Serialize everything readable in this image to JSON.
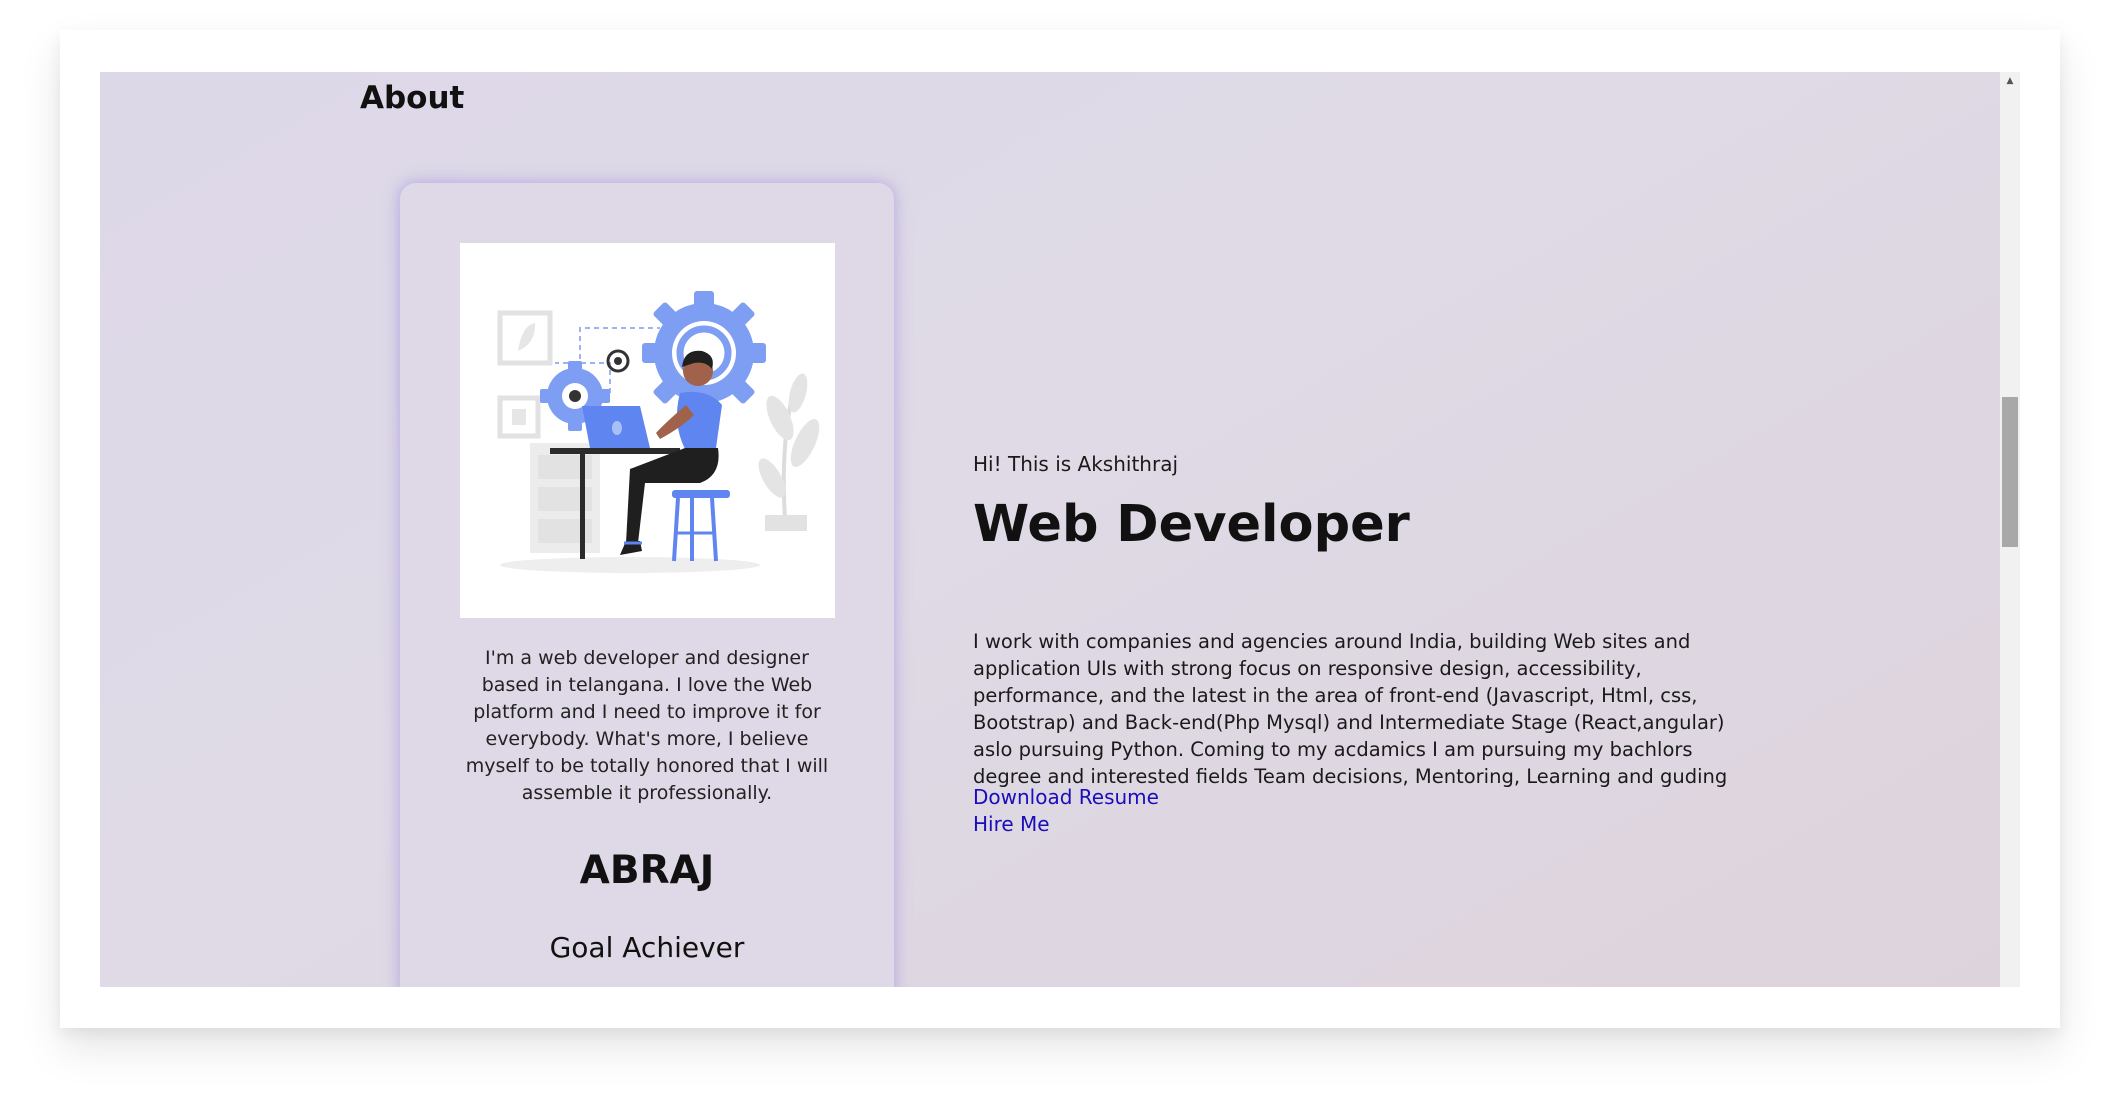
{
  "section": {
    "title": "About"
  },
  "card": {
    "bio": "I'm a web developer and designer based in telangana. I love the Web platform and I need to improve it for everybody. What's more, I believe myself to be totally honored that I will assemble it professionally.",
    "name": "ABRAJ",
    "role": "Goal Achiever",
    "illustration": "developer-at-laptop-with-gears-illustration"
  },
  "intro": {
    "greeting": "Hi! This is Akshithraj",
    "headline": "Web Developer",
    "description": "I work with companies and agencies around India, building Web sites and application UIs with strong focus on responsive design, accessibility, performance, and the latest in the area of front-end (Javascript, Html, css, Bootstrap) and Back-end(Php Mysql) and Intermediate Stage (React,angular) aslo pursuing Python. Coming to my acdamics I am pursuing my bachlors degree and interested fields Team decisions, Mentoring, Learning and guding",
    "links": {
      "resume": "Download Resume",
      "hire": "Hire Me"
    }
  },
  "scrollbar": {
    "position_fraction": 0.37
  },
  "colors": {
    "accent_blue": "#6a8ff3",
    "link": "#1a0dbb",
    "card_glow": "#8c78dc"
  }
}
